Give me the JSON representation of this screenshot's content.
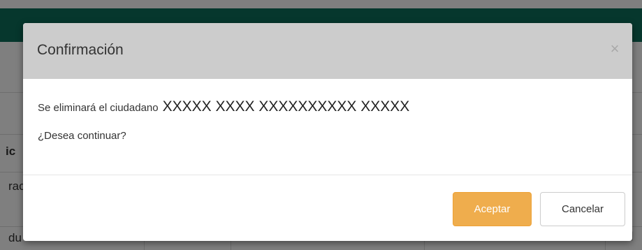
{
  "modal": {
    "title": "Confirmación",
    "close_glyph": "×",
    "message_prefix": "Se eliminará el ciudadano",
    "citizen_name": "XXXXX XXXX XXXXXXXXXX XXXXX",
    "question": "¿Desea continuar?",
    "accept_label": "Aceptar",
    "cancel_label": "Cancelar"
  },
  "background": {
    "header_color": "#0d6e5b",
    "fragments": {
      "header_cell": "ic",
      "row1_cell": "rac",
      "row2_cell": "du"
    }
  },
  "colors": {
    "accent_button": "#efad4d",
    "overlay": "rgba(0,0,0,0.5)",
    "modal_header": "#cccccc"
  },
  "icons": {
    "close": "close-icon"
  }
}
